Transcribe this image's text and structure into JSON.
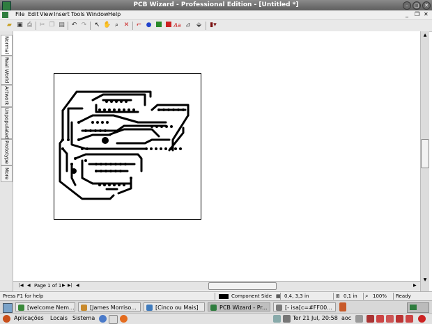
{
  "window": {
    "title": "PCB Wizard - Professional Edition - [Untitled *]"
  },
  "menu": [
    "File",
    "Edit",
    "View",
    "Insert",
    "Tools",
    "Window",
    "Help"
  ],
  "toolbar": {
    "icons": [
      "open-icon",
      "save-icon",
      "print-icon",
      "cut-icon",
      "copy-icon",
      "paste-icon",
      "undo-icon",
      "redo-icon",
      "pointer-icon",
      "hand-icon",
      "zoom-icon",
      "delete-icon",
      "track-icon",
      "pad-icon",
      "copper-area-icon",
      "rectangle-icon",
      "text-icon",
      "dimension-icon",
      "component-icon"
    ],
    "text_tool": "Aa"
  },
  "view_tabs": [
    "Normal",
    "Real World",
    "Artwork",
    "Unpopulated",
    "Prototype",
    "More"
  ],
  "navigation": {
    "page_label": "Page 1 of 1"
  },
  "status": {
    "help": "Press F1 for help",
    "layer": "Component Side",
    "coords": "0,4, 3,3 in",
    "grid": "0,1 in",
    "zoom": "100%",
    "state": "Ready"
  },
  "taskbar": {
    "tasks": [
      {
        "label": "[welcome Nem...",
        "color": "#3a8a3a"
      },
      {
        "label": "[James Morriso...",
        "color": "#c98a2c"
      },
      {
        "label": "[Cinco ou Mais]",
        "color": "#3f7bbd"
      },
      {
        "label": "PCB Wizard - Pr...",
        "color": "#2f7d3f"
      },
      {
        "label": "[- isa[c=#FF00...",
        "color": "#7a7a7a"
      }
    ]
  },
  "panel": {
    "menus": [
      "Aplicações",
      "Locais",
      "Sistema"
    ],
    "clock": "Ter 21 Jul, 20:58",
    "user": "aoc"
  },
  "colors": {
    "title_bg": "#6e6e6e",
    "track": "#000000",
    "accent_red": "#cc2222"
  }
}
